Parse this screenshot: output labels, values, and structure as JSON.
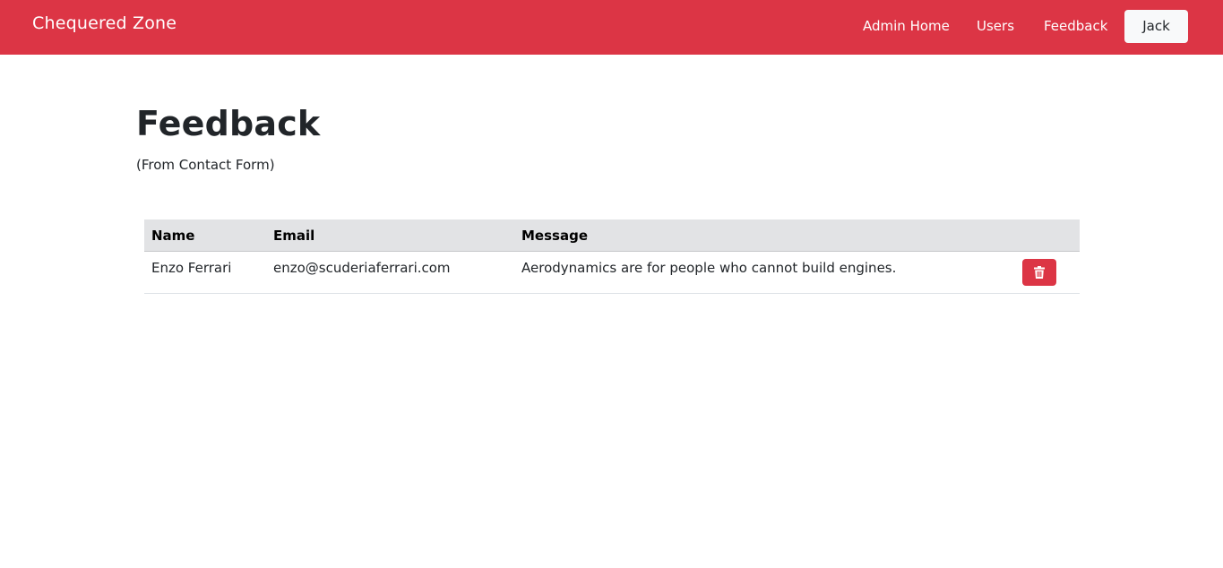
{
  "navbar": {
    "brand": "Chequered Zone",
    "links": [
      "Admin Home",
      "Users",
      "Feedback"
    ],
    "user": "Jack",
    "color": "#dc3545"
  },
  "page": {
    "title": "Feedback",
    "subtitle": "(From Contact Form)"
  },
  "table": {
    "headers": [
      "Name",
      "Email",
      "Message"
    ],
    "rows": [
      {
        "name": "Enzo Ferrari",
        "email": "enzo@scuderiaferrari.com",
        "message": "Aerodynamics are for people who cannot build engines.",
        "action_icon": "trash-icon"
      }
    ]
  }
}
